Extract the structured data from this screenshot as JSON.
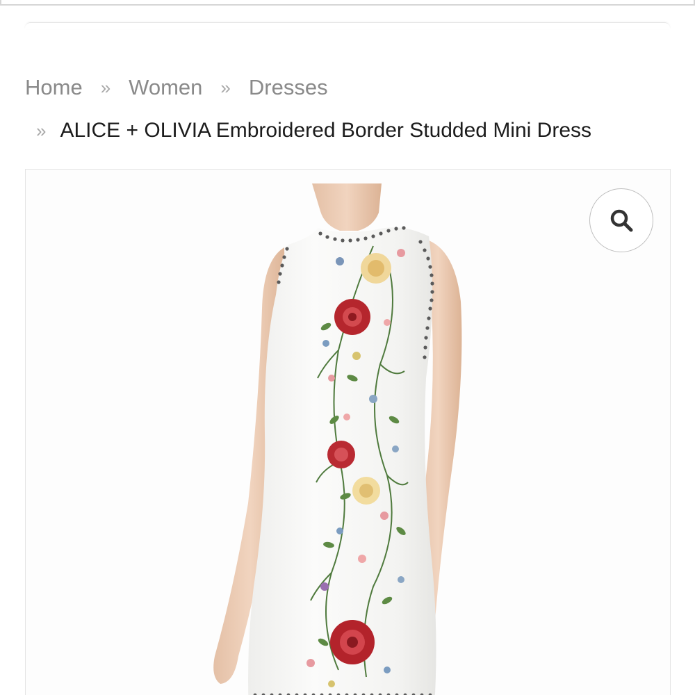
{
  "breadcrumb": {
    "items": [
      {
        "label": "Home"
      },
      {
        "label": "Women"
      },
      {
        "label": "Dresses"
      }
    ],
    "separator": "»",
    "current": "ALICE + OLIVIA Embroidered Border Studded Mini Dress"
  },
  "product_image": {
    "zoom_icon": "search-icon"
  },
  "colors": {
    "crumb_link": "#8a8a8a",
    "crumb_current": "#1c1c1c",
    "border": "#e4e4e4"
  }
}
